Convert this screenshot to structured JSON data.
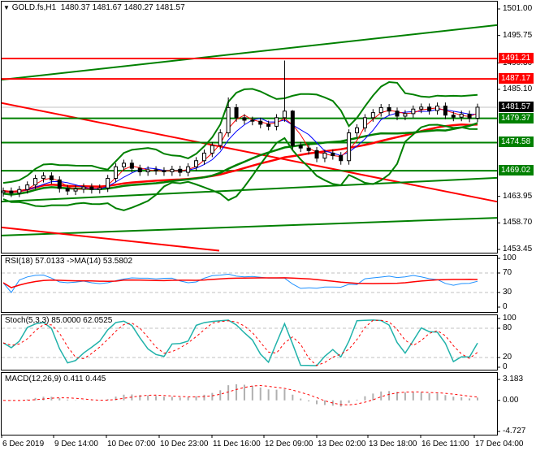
{
  "header": {
    "symbol": "GOLD.fs,H1",
    "ohlc": "1480.37 1481.67 1480.27 1481.57",
    "menu_icon": "triangle-down-icon"
  },
  "colors": {
    "bull": "#000000",
    "bear": "#ff0000",
    "green": "#008000",
    "red": "#ff0000",
    "blue": "#0000ff",
    "rsi": "#1e90ff",
    "stoch": "#20b2aa",
    "current_bg": "#000000"
  },
  "chart_data": [
    {
      "type": "candlestick",
      "title": "GOLD.fs,H1",
      "ylim": [
        1453.45,
        1501.0
      ],
      "y_ticks": [
        "1501.00",
        "1495.75",
        "1490.30",
        "1485.10",
        "1463.95",
        "1458.70",
        "1453.45"
      ],
      "closes": [
        1465.0,
        1464.6,
        1465.3,
        1466.2,
        1467.5,
        1468.0,
        1467.2,
        1465.5,
        1465.0,
        1465.4,
        1465.8,
        1465.3,
        1465.6,
        1467.5,
        1469.8,
        1470.5,
        1469.5,
        1468.8,
        1469.2,
        1469.0,
        1468.8,
        1469.3,
        1468.7,
        1469.8,
        1471.0,
        1472.5,
        1474.0,
        1476.5,
        1481.5,
        1479.5,
        1479.0,
        1478.8,
        1478.2,
        1477.8,
        1479.5,
        1480.8,
        1474.0,
        1473.5,
        1473.0,
        1471.5,
        1472.5,
        1472.0,
        1471.0,
        1476.5,
        1477.5,
        1479.5,
        1480.5,
        1481.5,
        1480.8,
        1479.8,
        1480.3,
        1481.2,
        1481.6,
        1480.9,
        1481.8,
        1480.0,
        1479.6,
        1480.2,
        1479.4,
        1481.57
      ],
      "special_highs": {
        "28": 1483.5,
        "35": 1490.8,
        "36": 1481.0
      },
      "current_price": "1481.57",
      "levels": [
        {
          "value": 1491.21,
          "label": "1491.21",
          "color": "red"
        },
        {
          "value": 1487.17,
          "label": "1487.17",
          "color": "red"
        },
        {
          "value": 1479.37,
          "label": "1479.37",
          "color": "green"
        },
        {
          "value": 1474.58,
          "label": "1474.58",
          "color": "green"
        },
        {
          "value": 1469.02,
          "label": "1469.02",
          "color": "green"
        }
      ],
      "trendlines": [
        {
          "from": 1487.0,
          "to": 1497.8,
          "color": "green"
        },
        {
          "from": 1482.4,
          "to": 1462.9,
          "color": "red"
        },
        {
          "from": 1462.9,
          "to": 1467.6,
          "color": "green"
        },
        {
          "from": 1456.2,
          "to": 1459.7,
          "color": "green"
        }
      ],
      "x_labels": [
        "6 Dec 2019",
        "9 Dec 14:00",
        "10 Dec 07:00",
        "10 Dec 23:00",
        "11 Dec 16:00",
        "12 Dec 09:00",
        "13 Dec 02:00",
        "13 Dec 18:00",
        "16 Dec 11:00",
        "17 Dec 04:00"
      ]
    },
    {
      "type": "line",
      "title": "RSI(18) 57.0133 ->MA(14) 53.5802",
      "ylim": [
        0,
        100
      ],
      "y_ticks": [
        "100",
        "70",
        "30",
        "0"
      ],
      "levels": [
        70,
        30
      ]
    },
    {
      "type": "line",
      "title": "Stoch(5,3,3) 85.0000 62.0525",
      "ylim": [
        0,
        100
      ],
      "y_ticks": [
        "100",
        "80",
        "20",
        "0"
      ],
      "levels": [
        80,
        20
      ]
    },
    {
      "type": "bar",
      "title": "MACD(12,26,9) 0.411 0.445",
      "ylim": [
        -4.727,
        3.183
      ],
      "y_ticks": [
        "3.183",
        "0.00",
        "-4.727"
      ]
    }
  ]
}
